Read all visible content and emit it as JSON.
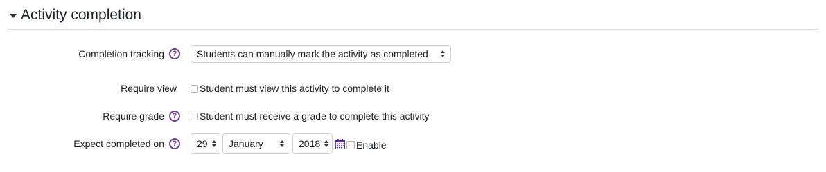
{
  "section": {
    "title": "Activity completion"
  },
  "fields": {
    "completion_tracking": {
      "label": "Completion tracking",
      "help_icon": "question-circle-icon",
      "selected": "Students can manually mark the activity as completed"
    },
    "require_view": {
      "label": "Require view",
      "checkbox_label": "Student must view this activity to complete it"
    },
    "require_grade": {
      "label": "Require grade",
      "help_icon": "question-circle-icon",
      "checkbox_label": "Student must receive a grade to complete this activity"
    },
    "expect_completed": {
      "label": "Expect completed on",
      "help_icon": "question-circle-icon",
      "day": "29",
      "month": "January",
      "year": "2018",
      "calendar_icon": "calendar-icon",
      "enable_label": "Enable"
    }
  },
  "colors": {
    "help_icon": "#6a3c8c",
    "calendar_icon": "#5b2e91",
    "text": "#1d2125",
    "divider": "#dee2e6"
  }
}
